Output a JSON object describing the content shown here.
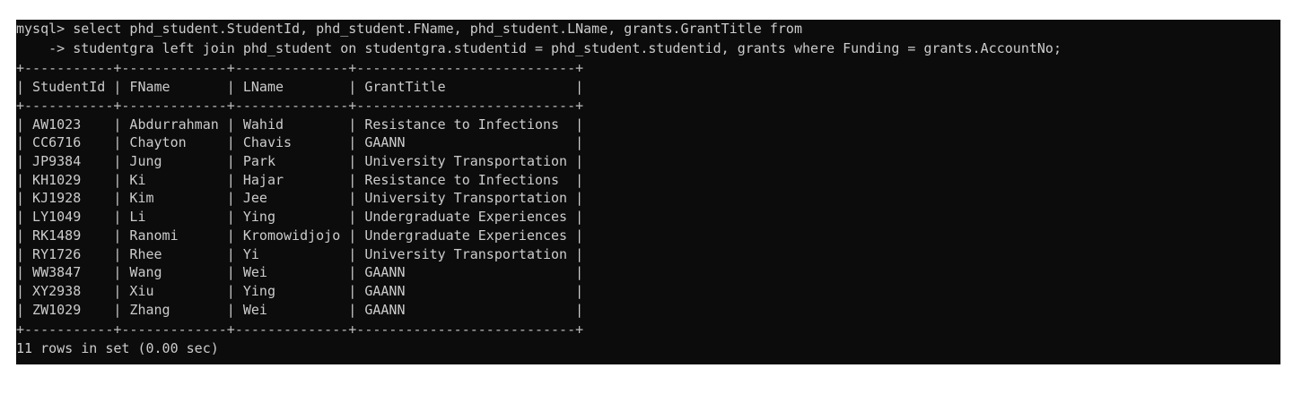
{
  "terminal": {
    "query_line_1": "mysql> select phd_student.StudentId, phd_student.FName, phd_student.LName, grants.GrantTitle from",
    "query_line_2": "    -> studentgra left join phd_student on studentgra.studentid = phd_student.studentid, grants where Funding = grants.AccountNo;",
    "table": {
      "border": "+-----------+-------------+--------------+---------------------------+",
      "header_row": "| StudentId | FName       | LName        | GrantTitle                |",
      "rows": [
        "| AW1023    | Abdurrahman | Wahid        | Resistance to Infections  |",
        "| CC6716    | Chayton     | Chavis       | GAANN                     |",
        "| JP9384    | Jung        | Park         | University Transportation |",
        "| KH1029    | Ki          | Hajar        | Resistance to Infections  |",
        "| KJ1928    | Kim         | Jee          | University Transportation |",
        "| LY1049    | Li          | Ying         | Undergraduate Experiences |",
        "| RK1489    | Ranomi      | Kromowidjojo | Undergraduate Experiences |",
        "| RY1726    | Rhee        | Yi           | University Transportation |",
        "| WW3847    | Wang        | Wei          | GAANN                     |",
        "| XY2938    | Xiu         | Ying         | GAANN                     |",
        "| ZW1029    | Zhang       | Wei          | GAANN                     |"
      ]
    },
    "result_summary": "11 rows in set (0.00 sec)"
  },
  "colors": {
    "terminal_background": "#0c0c0c",
    "terminal_text": "#cccccc",
    "page_background": "#ffffff"
  }
}
